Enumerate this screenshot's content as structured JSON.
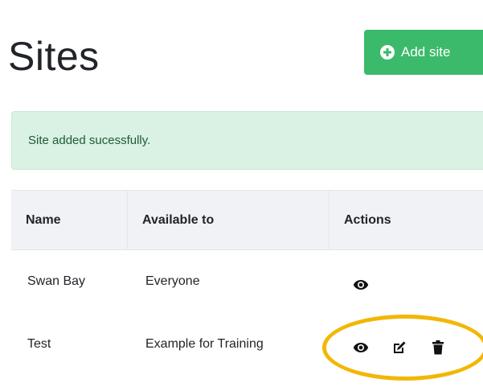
{
  "header": {
    "title": "Sites",
    "add_button_label": "Add site"
  },
  "alert": {
    "message": "Site added sucessfully."
  },
  "table": {
    "columns": [
      "Name",
      "Available to",
      "Actions"
    ],
    "rows": [
      {
        "name": "Swan Bay",
        "available_to": "Everyone",
        "actions": [
          "view-icon"
        ]
      },
      {
        "name": "Test",
        "available_to": "Example for Training",
        "actions": [
          "view-icon",
          "edit-icon",
          "delete-icon"
        ]
      }
    ]
  },
  "colors": {
    "success_button": "#3cba6b",
    "alert_background": "#d9f2e3",
    "highlight": "#f2b705"
  }
}
